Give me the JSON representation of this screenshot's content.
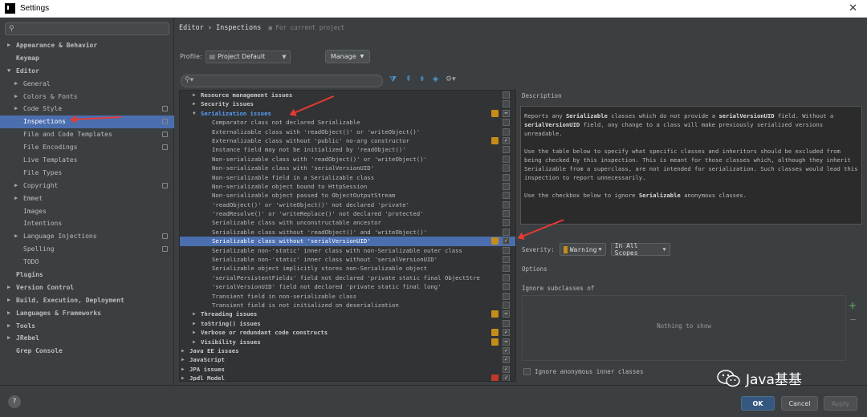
{
  "window": {
    "title": "Settings",
    "close_label": "✕"
  },
  "sidebar": {
    "items": [
      {
        "label": "Appearance & Behavior",
        "indent": 0,
        "arrow": "right",
        "bold": true
      },
      {
        "label": "Keymap",
        "indent": 0,
        "arrow": "",
        "bold": true
      },
      {
        "label": "Editor",
        "indent": 0,
        "arrow": "down",
        "bold": true
      },
      {
        "label": "General",
        "indent": 1,
        "arrow": "right"
      },
      {
        "label": "Colors & Fonts",
        "indent": 1,
        "arrow": "right"
      },
      {
        "label": "Code Style",
        "indent": 1,
        "arrow": "right",
        "project": true
      },
      {
        "label": "Inspections",
        "indent": 1,
        "arrow": "",
        "selected": true,
        "project": true
      },
      {
        "label": "File and Code Templates",
        "indent": 1,
        "arrow": "",
        "project": true
      },
      {
        "label": "File Encodings",
        "indent": 1,
        "arrow": "",
        "project": true
      },
      {
        "label": "Live Templates",
        "indent": 1,
        "arrow": ""
      },
      {
        "label": "File Types",
        "indent": 1,
        "arrow": ""
      },
      {
        "label": "Copyright",
        "indent": 1,
        "arrow": "right",
        "project": true
      },
      {
        "label": "Emmet",
        "indent": 1,
        "arrow": "right"
      },
      {
        "label": "Images",
        "indent": 1,
        "arrow": ""
      },
      {
        "label": "Intentions",
        "indent": 1,
        "arrow": ""
      },
      {
        "label": "Language Injections",
        "indent": 1,
        "arrow": "right",
        "project": true
      },
      {
        "label": "Spelling",
        "indent": 1,
        "arrow": "",
        "project": true
      },
      {
        "label": "TODO",
        "indent": 1,
        "arrow": ""
      },
      {
        "label": "Plugins",
        "indent": 0,
        "arrow": "",
        "bold": true
      },
      {
        "label": "Version Control",
        "indent": 0,
        "arrow": "right",
        "bold": true
      },
      {
        "label": "Build, Execution, Deployment",
        "indent": 0,
        "arrow": "right",
        "bold": true
      },
      {
        "label": "Languages & Frameworks",
        "indent": 0,
        "arrow": "right",
        "bold": true
      },
      {
        "label": "Tools",
        "indent": 0,
        "arrow": "right",
        "bold": true
      },
      {
        "label": "JRebel",
        "indent": 0,
        "arrow": "right",
        "bold": true
      },
      {
        "label": "Grep Console",
        "indent": 0,
        "arrow": "",
        "bold": true
      }
    ]
  },
  "breadcrumb": {
    "path": "Editor › Inspections",
    "hint": "For current project"
  },
  "profile": {
    "label": "Profile:",
    "value": "Project Default",
    "manage_label": "Manage"
  },
  "tree": {
    "rows": [
      {
        "label": "Resource management issues",
        "level": 1,
        "group": true,
        "arrow": "right",
        "sev": "",
        "check": "box"
      },
      {
        "label": "Security issues",
        "level": 1,
        "group": true,
        "arrow": "right",
        "sev": "",
        "check": "box"
      },
      {
        "label": "Serialization issues",
        "level": 1,
        "group": true,
        "arrow": "down",
        "link": true,
        "sev": "#c68c1a",
        "check": "partial"
      },
      {
        "label": "Comparator class not declared Serializable",
        "level": 2,
        "sev": "",
        "check": "box"
      },
      {
        "label": "Externalizable class with 'readObject()' or 'writeObject()'",
        "level": 2,
        "sev": "",
        "check": "box"
      },
      {
        "label": "Externalizable class without 'public' no-arg constructor",
        "level": 2,
        "sev": "#c68c1a",
        "check": "checked"
      },
      {
        "label": "Instance field may not be initialized by 'readObject()'",
        "level": 2,
        "sev": "",
        "check": "box"
      },
      {
        "label": "Non-serializable class with 'readObject()' or 'writeObject()'",
        "level": 2,
        "sev": "",
        "check": "box"
      },
      {
        "label": "Non-serializable class with 'serialVersionUID'",
        "level": 2,
        "sev": "",
        "check": "box"
      },
      {
        "label": "Non-serializable field in a Serializable class",
        "level": 2,
        "sev": "",
        "check": "box"
      },
      {
        "label": "Non-serializable object bound to HttpSession",
        "level": 2,
        "sev": "",
        "check": "box"
      },
      {
        "label": "Non-serializable object passed to ObjectOutputStream",
        "level": 2,
        "sev": "",
        "check": "box"
      },
      {
        "label": "'readObject()' or 'writeObject()' not declared 'private'",
        "level": 2,
        "sev": "",
        "check": "box"
      },
      {
        "label": "'readResolve()' or 'writeReplace()' not declared 'protected'",
        "level": 2,
        "sev": "",
        "check": "box"
      },
      {
        "label": "Serializable class with unconstructable ancestor",
        "level": 2,
        "sev": "",
        "check": "box"
      },
      {
        "label": "Serializable class without 'readObject()' and 'writeObject()'",
        "level": 2,
        "sev": "",
        "check": "box"
      },
      {
        "label": "Serializable class without 'serialVersionUID'",
        "level": 2,
        "sev": "#c68c1a",
        "check": "checked",
        "selected": true
      },
      {
        "label": "Serializable non-'static' inner class with non-Serializable outer class",
        "level": 2,
        "sev": "",
        "check": "box"
      },
      {
        "label": "Serializable non-'static' inner class without 'serialVersionUID'",
        "level": 2,
        "sev": "",
        "check": "box"
      },
      {
        "label": "Serializable object implicitly stores non-Serializable object",
        "level": 2,
        "sev": "",
        "check": "box"
      },
      {
        "label": "'serialPersistentFields' field not declared 'private static final ObjectStre",
        "level": 2,
        "sev": "",
        "check": "box"
      },
      {
        "label": "'serialVersionUID' field not declared 'private static final long'",
        "level": 2,
        "sev": "",
        "check": "box"
      },
      {
        "label": "Transient field in non-serializable class",
        "level": 2,
        "sev": "",
        "check": "box"
      },
      {
        "label": "Transient field is not initialized on deserialization",
        "level": 2,
        "sev": "",
        "check": "box"
      },
      {
        "label": "Threading issues",
        "level": 1,
        "group": true,
        "arrow": "right",
        "sev": "#c68c1a",
        "check": "partial"
      },
      {
        "label": "toString() issues",
        "level": 1,
        "group": true,
        "arrow": "right",
        "sev": "",
        "check": "box"
      },
      {
        "label": "Verbose or redundant code constructs",
        "level": 1,
        "group": true,
        "arrow": "right",
        "sev": "#c68c1a",
        "check": "checked"
      },
      {
        "label": "Visibility issues",
        "level": 1,
        "group": true,
        "arrow": "right",
        "sev": "#c68c1a",
        "check": "partial"
      },
      {
        "label": "Java EE issues",
        "level": 0,
        "group": true,
        "arrow": "right",
        "sev": "",
        "check": "checked"
      },
      {
        "label": "JavaScript",
        "level": 0,
        "group": true,
        "arrow": "right",
        "sev": "",
        "check": "checked"
      },
      {
        "label": "JPA issues",
        "level": 0,
        "group": true,
        "arrow": "right",
        "sev": "",
        "check": "checked"
      },
      {
        "label": "Jpdl Model",
        "level": 0,
        "group": true,
        "arrow": "right",
        "sev": "#c0392b",
        "check": "checked"
      }
    ]
  },
  "description": {
    "title": "Description",
    "p1_a": "Reports any ",
    "p1_b": "Serializable",
    "p1_c": " classes which do not provide a ",
    "p1_d": "serialVersionUID",
    "p1_e": " field. Without a ",
    "p1_f": "serialVersionUID",
    "p1_g": " field, any change to a class will make previously serialized versions unreadable.",
    "p2": "Use the table below to specify what specific classes and inheritors should be excluded from being checked by this inspection. This is meant for those classes which, although they inherit Serializable from a superclass, are not intended for serialization. Such classes would lead this inspection to report unnecessarily.",
    "p3_a": "Use the checkbox below to ignore ",
    "p3_b": "Serializable",
    "p3_c": " anonymous classes."
  },
  "severity": {
    "label": "Severity:",
    "value": "Warning",
    "scope": "In All Scopes",
    "color": "#c68c1a"
  },
  "options": {
    "title": "Options",
    "ignore_subclasses": "Ignore subclasses of",
    "empty_text": "Nothing to show",
    "anon_label": "Ignore anonymous inner classes"
  },
  "footer": {
    "help": "?",
    "ok": "OK",
    "cancel": "Cancel",
    "apply": "Apply"
  },
  "watermark": {
    "text": "Java基基"
  }
}
